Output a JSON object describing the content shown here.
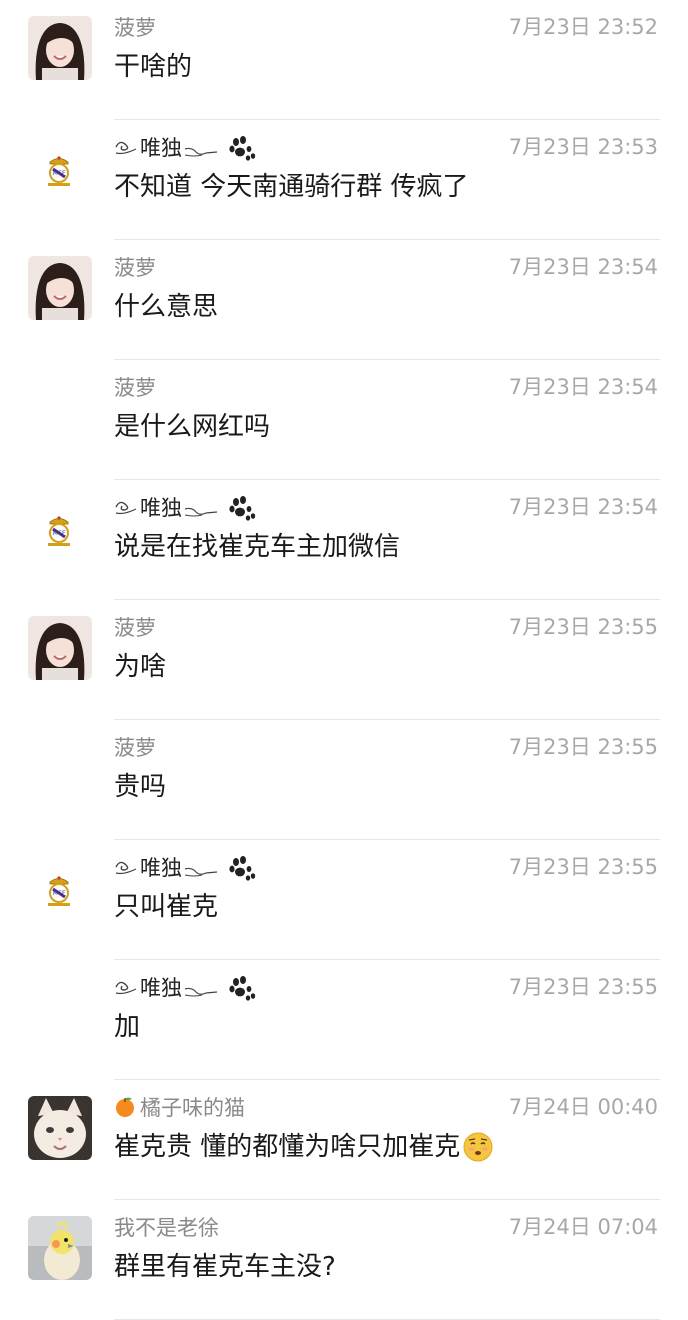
{
  "messages": [
    {
      "sender": "菠萝",
      "time": "7月23日 23:52",
      "text": "干啥的",
      "avatar": "girl-photo",
      "sender_style": "plain"
    },
    {
      "sender": "唯独",
      "time": "7月23日 23:53",
      "text": "不知道  今天南通骑行群 传疯了",
      "avatar": "real-madrid-crest",
      "sender_style": "decorated"
    },
    {
      "sender": "菠萝",
      "time": "7月23日 23:54",
      "text": "什么意思",
      "avatar": "girl-photo",
      "sender_style": "plain"
    },
    {
      "sender": "菠萝",
      "time": "7月23日 23:54",
      "text": "是什么网红吗",
      "avatar": "none",
      "sender_style": "plain"
    },
    {
      "sender": "唯独",
      "time": "7月23日 23:54",
      "text": "说是在找崔克车主加微信",
      "avatar": "real-madrid-crest",
      "sender_style": "decorated"
    },
    {
      "sender": "菠萝",
      "time": "7月23日 23:55",
      "text": "为啥",
      "avatar": "girl-photo",
      "sender_style": "plain"
    },
    {
      "sender": "菠萝",
      "time": "7月23日 23:55",
      "text": "贵吗",
      "avatar": "none",
      "sender_style": "plain"
    },
    {
      "sender": "唯独",
      "time": "7月23日 23:55",
      "text": "只叫崔克",
      "avatar": "real-madrid-crest",
      "sender_style": "decorated"
    },
    {
      "sender": "唯独",
      "time": "7月23日 23:55",
      "text": "加",
      "avatar": "none",
      "sender_style": "decorated"
    },
    {
      "sender": "橘子味的猫",
      "time": "7月24日 00:40",
      "text": "崔克贵 懂的都懂为啥只加崔克",
      "avatar": "cat-photo",
      "sender_style": "orange",
      "trailing_emoji": "relieved-face-emoji"
    },
    {
      "sender": "我不是老徐",
      "time": "7月24日 07:04",
      "text": "群里有崔克车主没?",
      "avatar": "bird-photo",
      "sender_style": "plain"
    }
  ],
  "colors": {
    "sender": "#8a8a8a",
    "time": "#a8a8a8",
    "text": "#1a1a1a",
    "divider": "#e6e6e6"
  }
}
